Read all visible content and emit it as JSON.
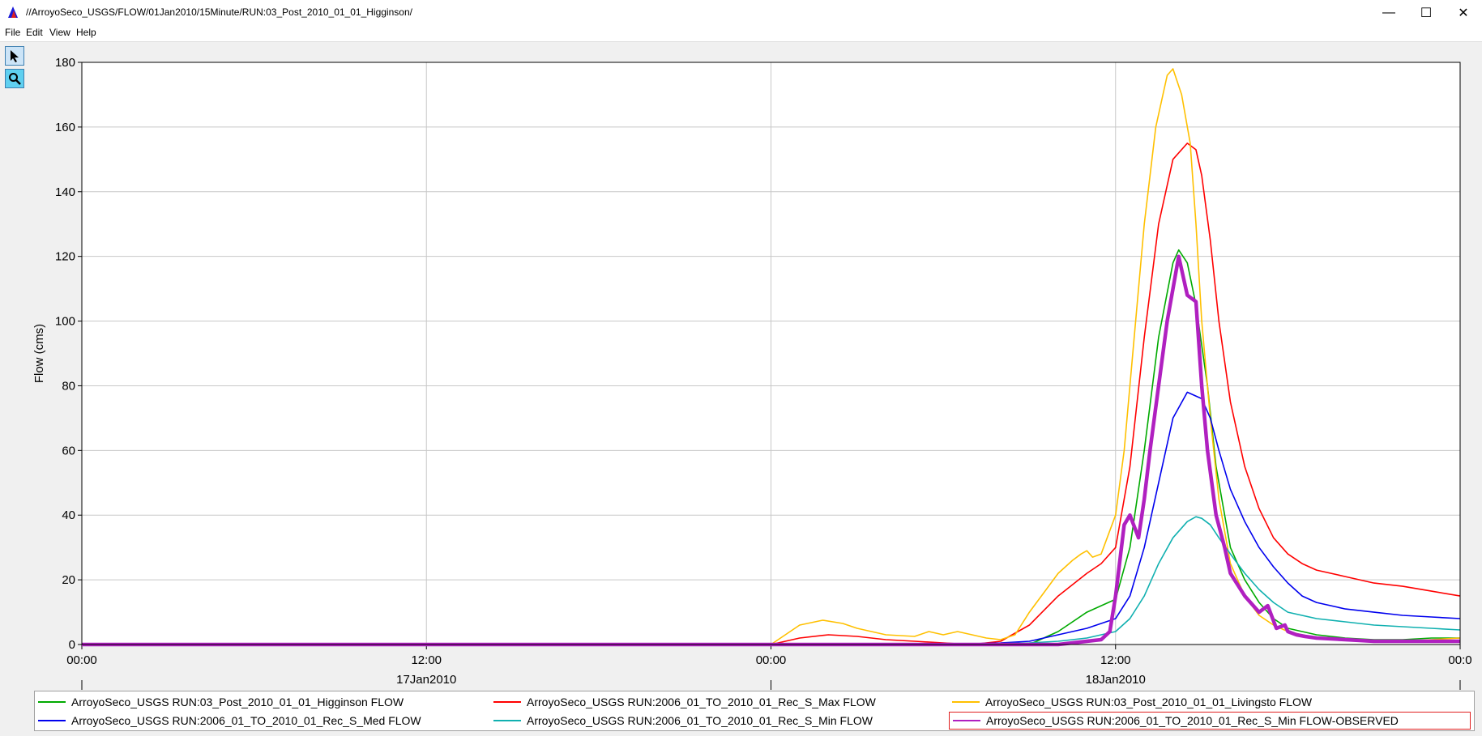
{
  "window": {
    "title": "//ArroyoSeco_USGS/FLOW/01Jan2010/15Minute/RUN:03_Post_2010_01_01_Higginson/",
    "minimize_glyph": "—",
    "maximize_glyph": "☐",
    "close_glyph": "✕"
  },
  "menu": [
    {
      "label": "File"
    },
    {
      "label": "Edit"
    },
    {
      "label": "View"
    },
    {
      "label": "Help"
    }
  ],
  "tools": [
    {
      "icon": "pointer-icon"
    },
    {
      "icon": "zoom-icon"
    }
  ],
  "chart_data": {
    "type": "line",
    "ylabel": "Flow (cms)",
    "ylim": [
      0,
      180
    ],
    "yticks": [
      0,
      20,
      40,
      60,
      80,
      100,
      120,
      140,
      160,
      180
    ],
    "x_unit": "hours from 17Jan2010 00:00",
    "xlim": [
      0,
      48
    ],
    "xticks": [
      {
        "x": 0,
        "label": "00:00"
      },
      {
        "x": 12,
        "label": "12:00"
      },
      {
        "x": 24,
        "label": "00:00"
      },
      {
        "x": 36,
        "label": "12:00"
      },
      {
        "x": 48,
        "label": "00:0"
      }
    ],
    "date_labels": [
      {
        "x": 12,
        "label": "17Jan2010"
      },
      {
        "x": 36,
        "label": "18Jan2010"
      }
    ],
    "grid": true,
    "legend_position": "bottom",
    "series": [
      {
        "name": "ArroyoSeco_USGS RUN:03_Post_2010_01_01_Higginson FLOW",
        "color": "#00aa00",
        "width": 1.6,
        "x": [
          0,
          24,
          33,
          34,
          35,
          35.5,
          36,
          36.5,
          37,
          37.5,
          38,
          38.2,
          38.5,
          38.8,
          39.2,
          39.5,
          40,
          40.5,
          41,
          41.5,
          42,
          43,
          44,
          45,
          46,
          47,
          48
        ],
        "y": [
          0,
          0,
          0,
          4,
          10,
          12,
          14,
          30,
          60,
          95,
          118,
          122,
          118,
          105,
          80,
          55,
          30,
          20,
          13,
          8,
          5,
          3,
          2,
          1.5,
          1.5,
          2,
          2
        ]
      },
      {
        "name": "ArroyoSeco_USGS RUN:2006_01_TO_2010_01_Rec_S_Max FLOW",
        "color": "#ff0000",
        "width": 1.6,
        "x": [
          0,
          24,
          25,
          26,
          27,
          28,
          29,
          30,
          31,
          32,
          33,
          34,
          35,
          35.5,
          36,
          36.5,
          37,
          37.5,
          38,
          38.5,
          38.8,
          39,
          39.3,
          39.6,
          40,
          40.5,
          41,
          41.5,
          42,
          42.5,
          43,
          44,
          45,
          46,
          47,
          48
        ],
        "y": [
          0,
          0,
          2,
          3,
          2.5,
          1.5,
          1,
          0.5,
          0,
          1,
          6,
          15,
          22,
          25,
          30,
          55,
          95,
          130,
          150,
          155,
          153,
          145,
          125,
          100,
          75,
          55,
          42,
          33,
          28,
          25,
          23,
          21,
          19,
          18,
          16.5,
          15
        ]
      },
      {
        "name": "ArroyoSeco_USGS RUN:03_Post_2010_01_01_Livingsto FLOW",
        "color": "#ffc000",
        "width": 1.6,
        "x": [
          0,
          24,
          25,
          25.8,
          26.5,
          27,
          28,
          29,
          29.5,
          30,
          30.5,
          31,
          31.5,
          32,
          32.5,
          33,
          33.5,
          34,
          34.5,
          34.8,
          35,
          35.2,
          35.5,
          36,
          36.3,
          36.6,
          37,
          37.4,
          37.8,
          38,
          38.3,
          38.6,
          38.8,
          39,
          39.3,
          39.6,
          40,
          40.5,
          41,
          41.5,
          42,
          43,
          44,
          45,
          46,
          47,
          48
        ],
        "y": [
          0,
          0,
          6,
          7.5,
          6.5,
          5,
          3,
          2.5,
          4,
          3,
          4,
          3,
          2,
          1.5,
          3,
          10,
          16,
          22,
          26,
          28,
          29,
          27,
          28,
          40,
          60,
          90,
          130,
          160,
          176,
          178,
          170,
          155,
          130,
          100,
          70,
          45,
          25,
          15,
          9,
          6,
          4,
          2,
          1.5,
          1,
          1,
          1.5,
          2
        ]
      },
      {
        "name": "ArroyoSeco_USGS RUN:2006_01_TO_2010_01_Rec_S_Med FLOW",
        "color": "#0000ee",
        "width": 1.6,
        "x": [
          0,
          24,
          30,
          32,
          33,
          34,
          35,
          36,
          36.5,
          37,
          37.5,
          38,
          38.5,
          39,
          39.3,
          39.6,
          40,
          40.5,
          41,
          41.5,
          42,
          42.5,
          43,
          44,
          45,
          46,
          47,
          48
        ],
        "y": [
          0,
          0,
          0,
          0.5,
          1,
          3,
          5,
          8,
          15,
          30,
          50,
          70,
          78,
          76,
          70,
          60,
          48,
          38,
          30,
          24,
          19,
          15,
          13,
          11,
          10,
          9,
          8.5,
          8
        ]
      },
      {
        "name": "ArroyoSeco_USGS RUN:2006_01_TO_2010_01_Rec_S_Min FLOW",
        "color": "#10b0b0",
        "width": 1.6,
        "x": [
          0,
          24,
          30,
          33,
          34,
          35,
          36,
          36.5,
          37,
          37.5,
          38,
          38.5,
          38.8,
          39,
          39.3,
          39.6,
          40,
          40.5,
          41,
          41.5,
          42,
          43,
          44,
          45,
          46,
          47,
          48
        ],
        "y": [
          0,
          0,
          0,
          0.5,
          1,
          2,
          4,
          8,
          15,
          25,
          33,
          38,
          39.5,
          39,
          37,
          33,
          28,
          22,
          17,
          13,
          10,
          8,
          7,
          6,
          5.5,
          5,
          4.5
        ]
      },
      {
        "name": "ArroyoSeco_USGS RUN:2006_01_TO_2010_01_Rec_S_Min FLOW-OBSERVED",
        "color": "#b020c0",
        "width": 4.5,
        "x": [
          0,
          24,
          34,
          35,
          35.5,
          35.8,
          36,
          36.3,
          36.5,
          36.8,
          37,
          37.2,
          37.5,
          37.8,
          38,
          38.2,
          38.5,
          38.8,
          39,
          39.2,
          39.5,
          39.8,
          40,
          40.5,
          41,
          41.3,
          41.6,
          41.9,
          42,
          42.3,
          42.6,
          43,
          44,
          45,
          46,
          47,
          48
        ],
        "y": [
          0,
          0,
          0,
          1,
          1.5,
          4,
          15,
          37,
          40,
          33,
          45,
          60,
          80,
          100,
          110,
          120,
          108,
          106,
          80,
          60,
          40,
          30,
          22,
          15,
          10,
          12,
          5,
          6,
          4,
          3,
          2.5,
          2,
          1.5,
          1,
          1,
          1,
          1
        ]
      }
    ]
  }
}
